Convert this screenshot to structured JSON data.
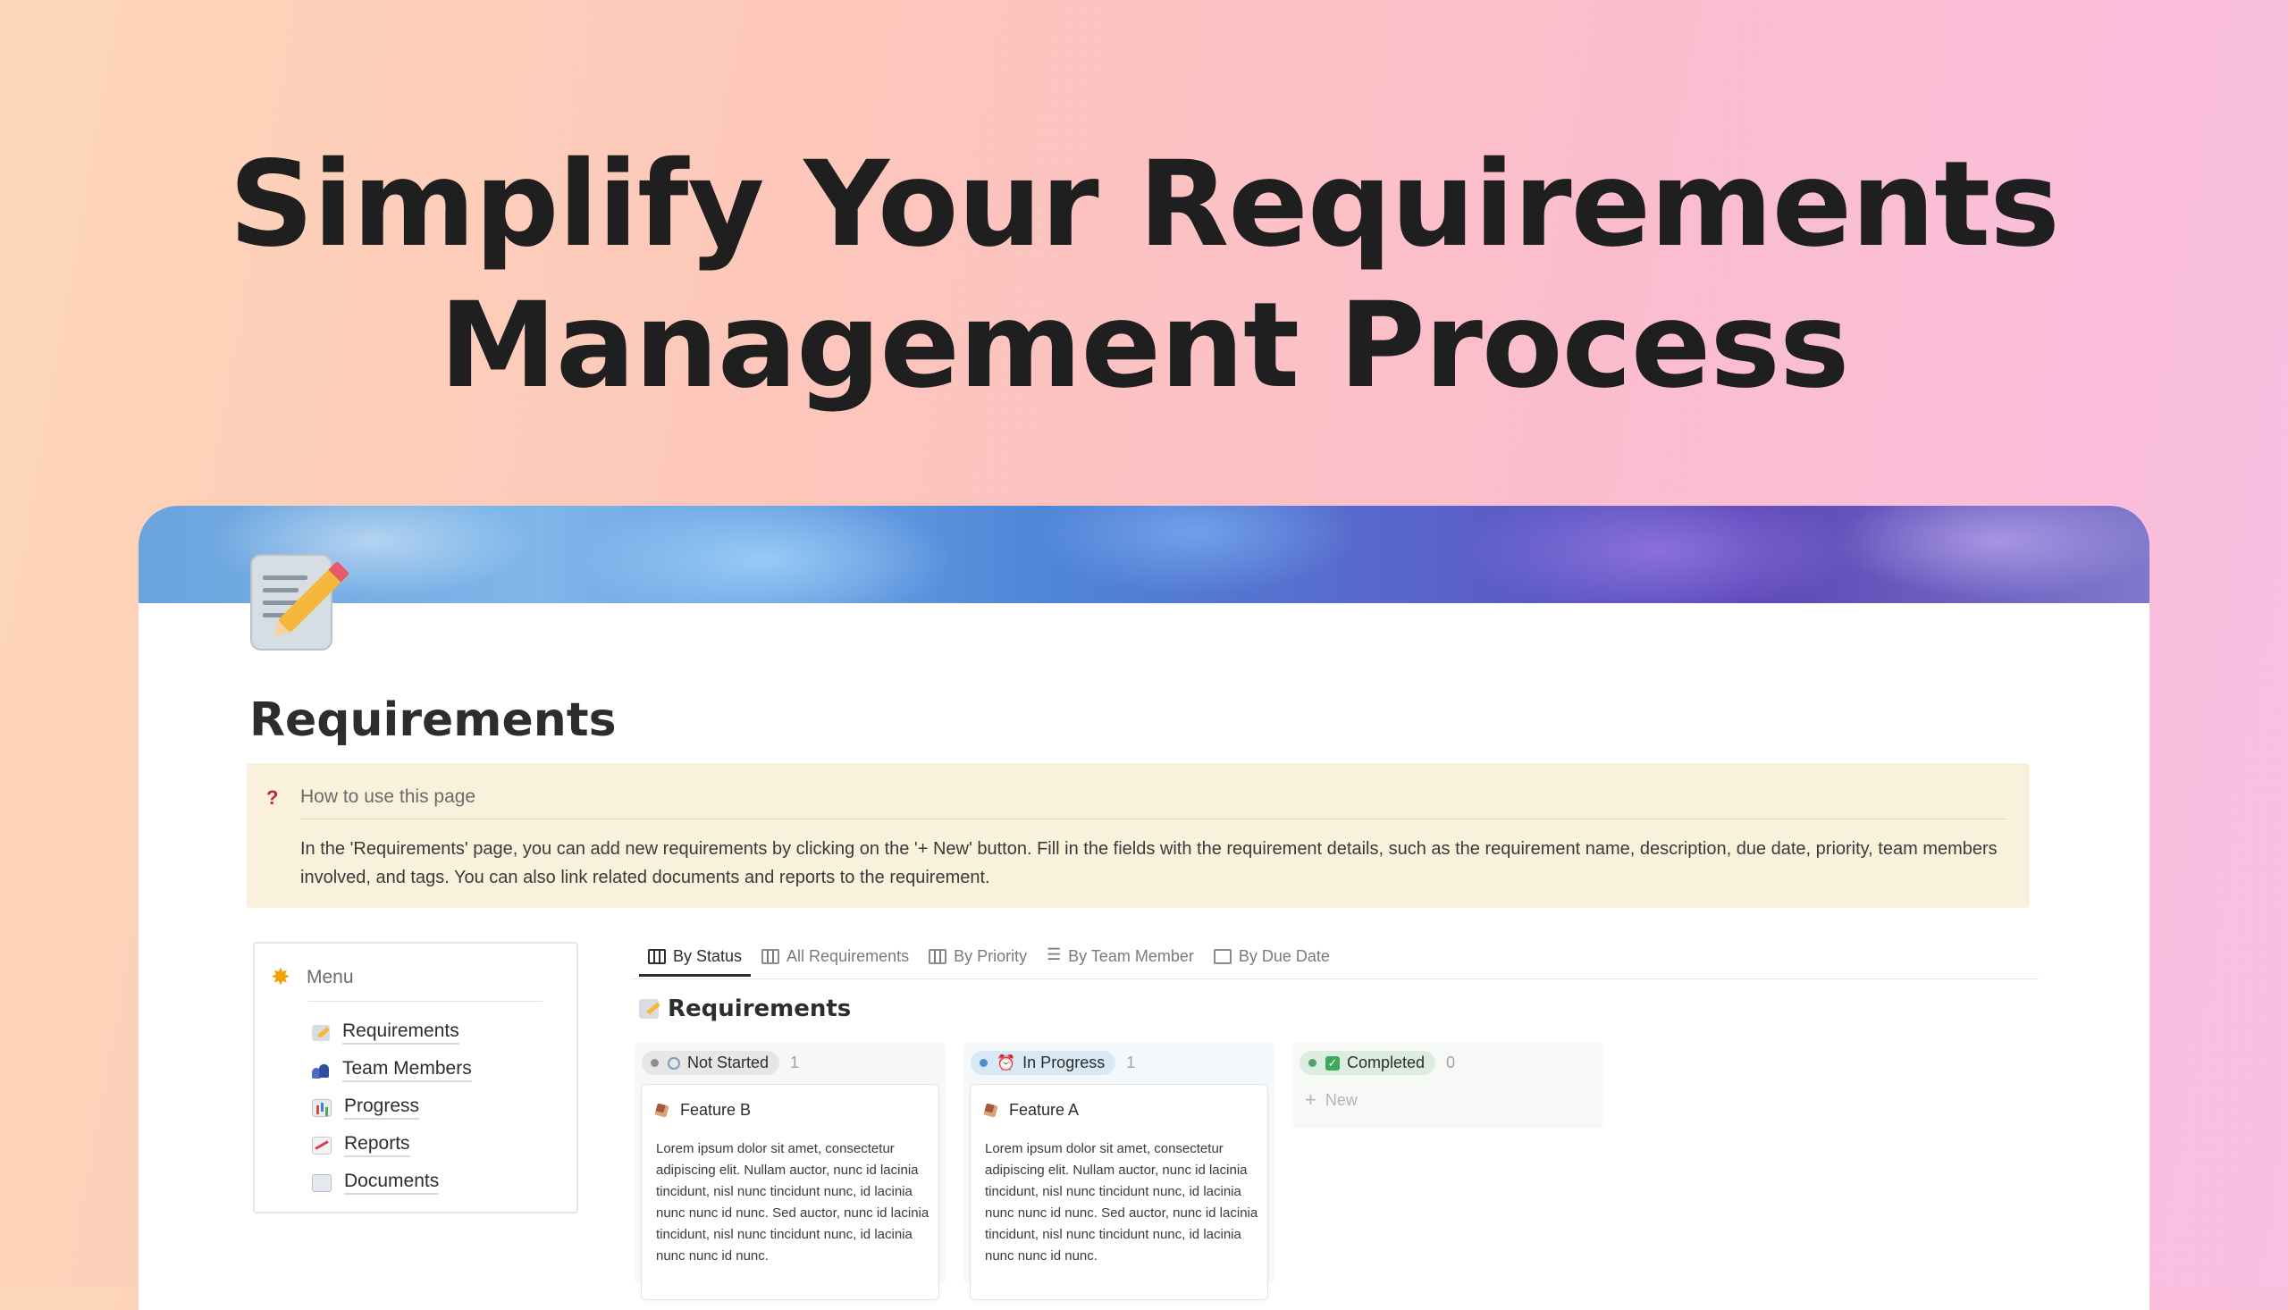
{
  "hero": {
    "line1": "Simplify Your Requirements",
    "line2": "Management Process"
  },
  "page": {
    "icon": "memo-pencil-icon",
    "title": "Requirements"
  },
  "callout": {
    "icon": "question-mark-icon",
    "heading": "How to use this page",
    "body": "In the 'Requirements' page, you can add new requirements by clicking on the '+ New' button. Fill in the fields with the requirement details, such as the requirement name, description, due date, priority, team members involved, and tags. You can also link related documents and reports to the requirement."
  },
  "menu": {
    "heading": "Menu",
    "items": [
      {
        "label": "Requirements",
        "icon": "memo-icon"
      },
      {
        "label": "Team Members",
        "icon": "people-icon"
      },
      {
        "label": "Progress",
        "icon": "bar-chart-icon"
      },
      {
        "label": "Reports",
        "icon": "chart-up-icon"
      },
      {
        "label": "Documents",
        "icon": "document-icon"
      }
    ]
  },
  "tabs": [
    {
      "label": "By Status",
      "icon": "board-icon",
      "active": true
    },
    {
      "label": "All Requirements",
      "icon": "table-icon",
      "active": false
    },
    {
      "label": "By Priority",
      "icon": "board-icon",
      "active": false
    },
    {
      "label": "By Team Member",
      "icon": "list-icon",
      "active": false
    },
    {
      "label": "By Due Date",
      "icon": "calendar-icon",
      "active": false
    }
  ],
  "database": {
    "title": "Requirements",
    "columns": [
      {
        "status": "Not Started",
        "count": "1",
        "color": "#8e8e8e",
        "cards": [
          {
            "title": "Feature B",
            "description": "Lorem ipsum dolor sit amet, consectetur adipiscing elit. Nullam auctor, nunc id lacinia tincidunt, nisl nunc tincidunt nunc, id lacinia nunc nunc id nunc. Sed auctor, nunc id lacinia tincidunt, nisl nunc tincidunt nunc, id lacinia nunc nunc id nunc."
          }
        ]
      },
      {
        "status": "In Progress",
        "count": "1",
        "color": "#4d8fd0",
        "cards": [
          {
            "title": "Feature A",
            "description": "Lorem ipsum dolor sit amet, consectetur adipiscing elit. Nullam auctor, nunc id lacinia tincidunt, nisl nunc tincidunt nunc, id lacinia nunc nunc id nunc. Sed auctor, nunc id lacinia tincidunt, nisl nunc tincidunt nunc, id lacinia nunc nunc id nunc."
          }
        ]
      },
      {
        "status": "Completed",
        "count": "0",
        "color": "#55a26a",
        "new_label": "New"
      }
    ]
  }
}
